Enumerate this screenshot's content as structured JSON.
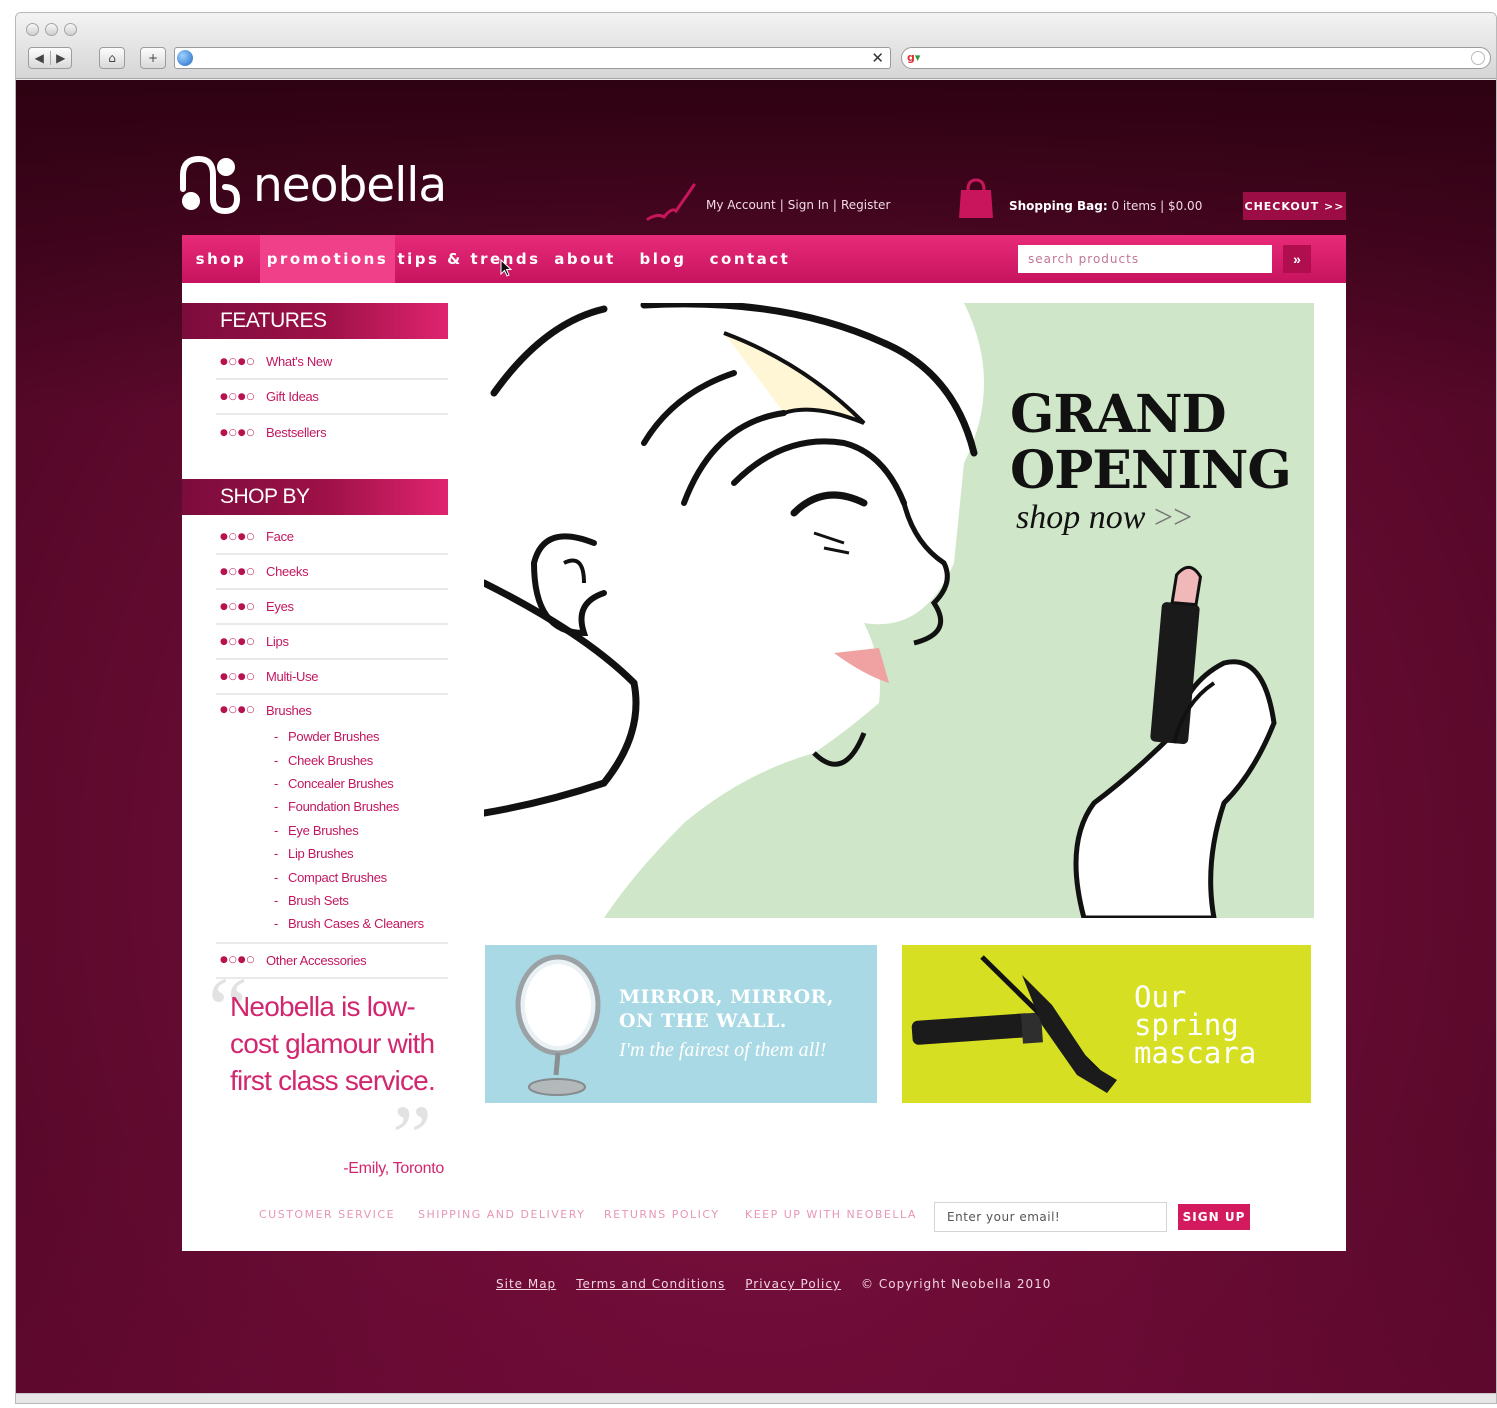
{
  "browser": {
    "url": "",
    "search_query": ""
  },
  "header": {
    "logo_text": "neobella",
    "account_links": [
      "My Account",
      "Sign In",
      "Register"
    ],
    "bag_label": "Shopping Bag:",
    "bag_info": " 0 items | $0.00",
    "checkout_label": "CHECKOUT >>"
  },
  "nav": {
    "items": [
      {
        "label": "shop",
        "active": false
      },
      {
        "label": "promotions",
        "active": true
      },
      {
        "label": "tips & trends",
        "active": false
      },
      {
        "label": "about",
        "active": false
      },
      {
        "label": "blog",
        "active": false
      },
      {
        "label": "contact",
        "active": false
      }
    ],
    "search_placeholder": "search products",
    "search_button": "»"
  },
  "sidebar": {
    "features_title": "FEATURES",
    "features": [
      "What's New",
      "Gift Ideas",
      "Bestsellers"
    ],
    "shopby_title": "SHOP BY",
    "shopby": [
      "Face",
      "Cheeks",
      "Eyes",
      "Lips",
      "Multi-Use",
      "Brushes"
    ],
    "brushes_sub": [
      "Powder Brushes",
      "Cheek Brushes",
      "Concealer Brushes",
      "Foundation Brushes",
      "Eye Brushes",
      "Lip Brushes",
      "Compact Brushes",
      "Brush Sets",
      "Brush Cases & Cleaners"
    ],
    "other": "Other Accessories",
    "dots": "●○●○"
  },
  "quote": {
    "text": "Neobella is low-cost glamour with first class service.",
    "author": "-Emily, Toronto"
  },
  "hero": {
    "title_line1": "GRAND",
    "title_line2": "OPENING",
    "subtitle": "shop now",
    "subtitle_arrow": " >>"
  },
  "promos": {
    "mirror_line1": "MIRROR, MIRROR,",
    "mirror_line2": "ON THE WALL.",
    "mirror_sub": "I'm the fairest of them all!",
    "mascara_line1": "Our",
    "mascara_line2": "spring",
    "mascara_line3": "mascara"
  },
  "footer": {
    "links": [
      "CUSTOMER SERVICE",
      "SHIPPING AND DELIVERY",
      "RETURNS POLICY",
      "KEEP UP WITH NEOBELLA"
    ],
    "email_placeholder": "Enter your email!",
    "signup_label": "SIGN UP",
    "bottom_links": [
      "Site Map",
      "Terms and Conditions",
      "Privacy Policy"
    ],
    "copyright": "© Copyright Neobella 2010"
  },
  "colors": {
    "brand_pink": "#d41a5f",
    "nav_pink": "#e82b79",
    "background_wine": "#6d0d36",
    "hero_green": "#cfe6c8",
    "mirror_blue": "#a9d9e4",
    "mascara_yellow": "#d6df22"
  }
}
